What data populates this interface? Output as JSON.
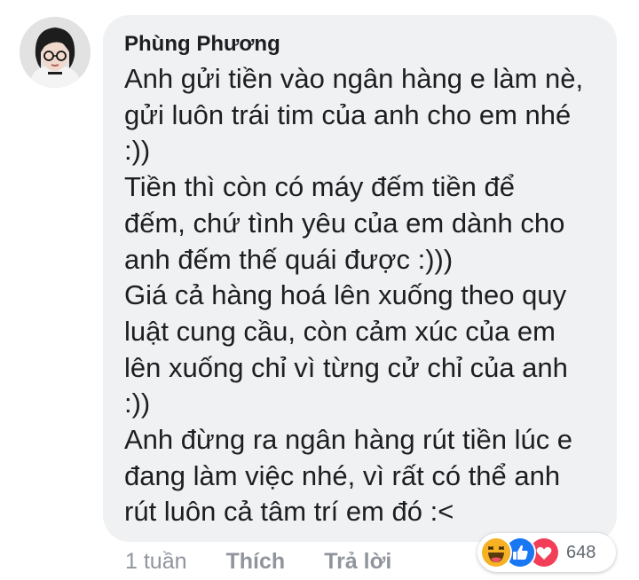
{
  "comment": {
    "author": "Phùng Phương",
    "lines": [
      "Anh gửi tiền vào ngân hàng e làm nè,",
      "gửi luôn trái tim của anh cho em nhé",
      ":))",
      "Tiền thì còn có máy đếm tiền để",
      "đếm, chứ tình yêu của em dành cho",
      "anh đếm thế quái được :)))",
      "Giá cả hàng hoá lên xuống theo quy",
      "luật cung cầu, còn cảm xúc của em",
      "lên xuống chỉ vì từng cử chỉ của anh",
      ":))",
      "Anh đừng ra ngân hàng rút tiền lúc e",
      "đang làm việc nhé, vì rất có thể anh",
      "rút luôn cả tâm trí em đó :<"
    ]
  },
  "actions": {
    "time": "1 tuần",
    "like": "Thích",
    "reply": "Trả lời"
  },
  "reactions": {
    "icons": [
      "haha-icon",
      "like-icon",
      "love-icon"
    ],
    "count": "648",
    "colors": {
      "haha": "#f7b125",
      "like": "#1877f2",
      "love": "#f33e58"
    }
  }
}
